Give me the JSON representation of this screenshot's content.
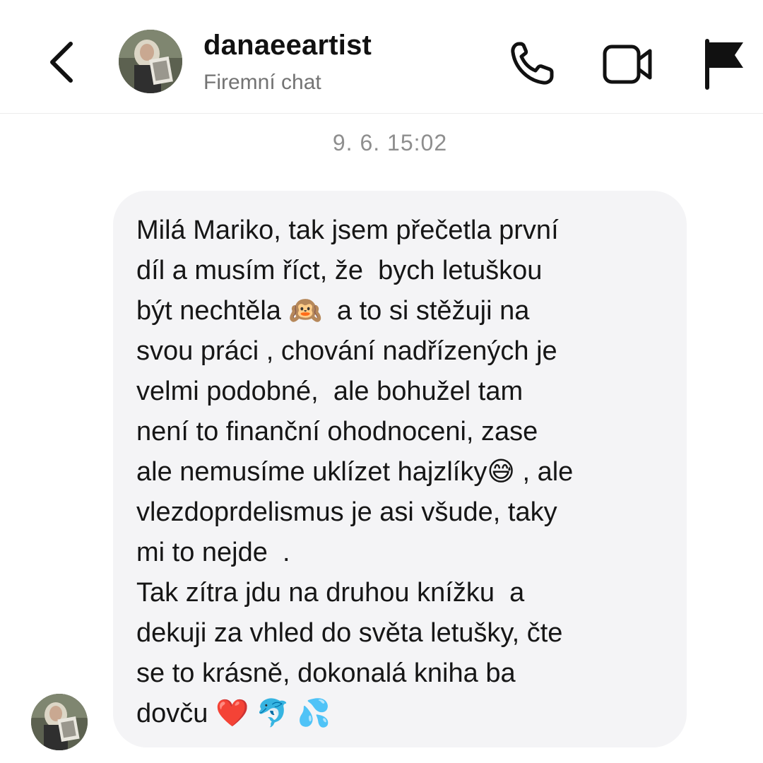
{
  "header": {
    "username": "danaeeartist",
    "subtitle": "Firemní chat",
    "icons": {
      "back": "chevron-left-icon",
      "call": "phone-icon",
      "video": "video-camera-icon",
      "report": "flag-icon"
    }
  },
  "thread": {
    "timestamp": "9. 6. 15:02",
    "message": {
      "lines": [
        "Milá Mariko, tak jsem přečetla první",
        "díl a musím říct, že  bych letuškou",
        "být nechtěla 🙉  a to si stěžuji na",
        "svou práci , chování nadřízených je",
        "velmi podobné,  ale bohužel tam",
        "není to finanční ohodnoceni, zase",
        "ale nemusíme uklízet hajzlíky😅 , ale",
        "vlezdoprdelismus je asi všude, taky",
        "mi to nejde  .",
        "Tak zítra jdu na druhou knížku  a",
        "dekuji za vhled do světa letušky, čte",
        "se to krásně, dokonalá kniha ba",
        "dovču ❤️ 🐬 💦"
      ]
    }
  },
  "colors": {
    "bubble_bg": "#f4f4f6",
    "secondary_text": "#737373",
    "timestamp_text": "#8e8e8e"
  }
}
